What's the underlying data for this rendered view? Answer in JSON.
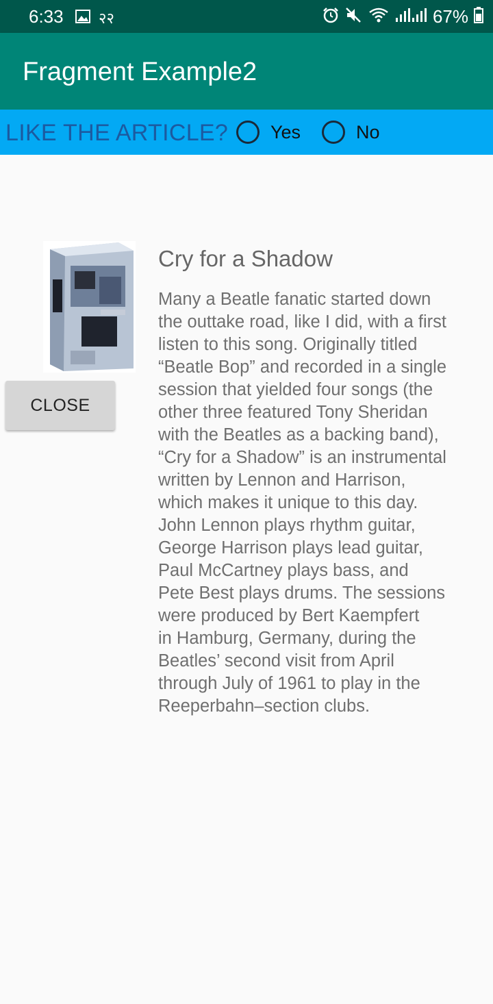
{
  "status_bar": {
    "time": "6:33",
    "extra_glyph": "२२",
    "battery_percent": "67%",
    "icons": [
      "image-icon",
      "alarm-icon",
      "mute-icon",
      "wifi-icon",
      "signal-icon",
      "battery-icon"
    ]
  },
  "app_bar": {
    "title": "Fragment Example2"
  },
  "question": {
    "label": "LIKE THE ARTICLE?",
    "options": [
      "Yes",
      "No"
    ]
  },
  "article": {
    "title": "Cry for a Shadow",
    "lines": [
      "Many a Beatle fanatic started down",
      "the outtake road, like I did, with a first",
      "listen to this song. Originally titled",
      "“Beatle Bop” and recorded in a single",
      "session that yielded four songs (the",
      "other three featured Tony Sheridan",
      "with the Beatles as a backing band),",
      "“Cry for a Shadow” is an instrumental",
      "written by Lennon and Harrison,",
      "which makes it unique to this day.",
      "John Lennon plays rhythm guitar,",
      "George Harrison plays lead guitar,",
      "Paul McCartney plays bass, and",
      "Pete Best plays drums. The sessions",
      "were produced by Bert Kaempfert",
      "in Hamburg, Germany, during the",
      "Beatles’ second visit from April",
      "through July of 1961 to play in the",
      "Reeperbahn–section clubs."
    ],
    "close_label": "CLOSE",
    "image_icon": "album-box-icon"
  },
  "colors": {
    "status_bar": "#00574b",
    "app_bar": "#008577",
    "question_bar": "#03a9f4",
    "question_text": "#1c5aa0"
  }
}
